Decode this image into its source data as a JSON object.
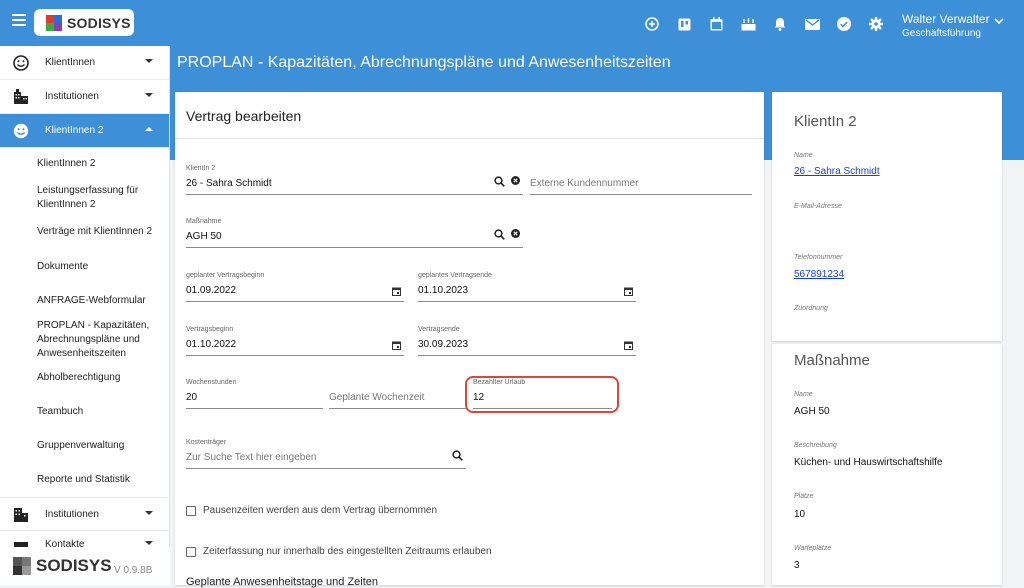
{
  "header": {
    "logo_text": "SODISYS",
    "user_name": "Walter Verwalter",
    "user_role": "Geschäftsführung",
    "icons": [
      "plus-circle-icon",
      "board-icon",
      "calendar-icon",
      "cake-icon",
      "bell-icon",
      "mail-icon",
      "check-circle-icon",
      "gear-icon"
    ]
  },
  "sidebar": {
    "top": [
      {
        "label": "KlientInnen",
        "icon": "smiley-icon"
      },
      {
        "label": "Institutionen",
        "icon": "buildings-icon"
      },
      {
        "label": "KlientInnen 2",
        "icon": "smiley-icon"
      }
    ],
    "sub": [
      "KlientInnen 2",
      "Leistungserfassung für KlientInnen 2",
      "Verträge mit KlientInnen 2",
      "Dokumente",
      "ANFRAGE-Webformular",
      "PROPLAN - Kapazitäten, Abrechnungspläne und Anwesenheitszeiten",
      "Abholberechtigung",
      "Teambuch",
      "Gruppenverwaltung",
      "Reporte und Statistik"
    ],
    "bottom": [
      {
        "label": "Institutionen",
        "icon": "building-icon"
      },
      {
        "label": "Kontakte",
        "icon": "contacts-icon"
      }
    ],
    "footer_brand": "SODISYS",
    "version": "V 0.9.8B"
  },
  "page_title": "PROPLAN - Kapazitäten, Abrechnungspläne und Anwesenheitszeiten",
  "form": {
    "title": "Vertrag bearbeiten",
    "klient_label": "KlientIn 2",
    "klient_value": "26 - Sahra  Schmidt",
    "kundennummer_placeholder": "Externe Kundennummer",
    "massnahme_label": "Maßnahme",
    "massnahme_value": "AGH 50",
    "geplanter_beginn_label": "geplanter Vertragsbeginn",
    "geplanter_beginn_value": "01.09.2022",
    "geplantes_ende_label": "geplantes Vertragsende",
    "geplantes_ende_value": "01.10.2023",
    "beginn_label": "Vertragsbeginn",
    "beginn_value": "01.10.2022",
    "ende_label": "Vertragsende",
    "ende_value": "30.09.2023",
    "wochenstunden_label": "Wochenstunden",
    "wochenstunden_value": "20",
    "wochenzeit_placeholder": "Geplante Wochenzeit",
    "urlaub_label": "Bezahlter Urlaub",
    "urlaub_value": "12",
    "kostentraeger_label": "Kostenträger",
    "kostentraeger_placeholder": "Zur Suche Text hier eingeben",
    "checkbox_pause": "Pausenzeiten werden aus dem Vertrag übernommen",
    "checkbox_zeit": "Zeiterfassung nur innerhalb des eingestellten Zeitraums erlauben",
    "section_heading": "Geplante Anwesenheitstage und Zeiten"
  },
  "client_card": {
    "title": "KlientIn 2",
    "name_label": "Name",
    "name_value": "26 - Sahra Schmidt",
    "email_label": "E-Mail-Adresse",
    "phone_label": "Telefonnummer",
    "phone_value": "567891234",
    "assign_label": "Zuordnung"
  },
  "measure_card": {
    "title": "Maßnahme",
    "name_label": "Name",
    "name_value": "AGH 50",
    "desc_label": "Beschreibung",
    "desc_value": "Küchen- und Hauswirtschaftshilfe",
    "places_label": "Plätze",
    "places_value": "10",
    "waiting_label": "Warteplätze",
    "waiting_value": "3"
  },
  "colors": {
    "primary": "#3d8fd8",
    "highlight": "#d9483b"
  }
}
